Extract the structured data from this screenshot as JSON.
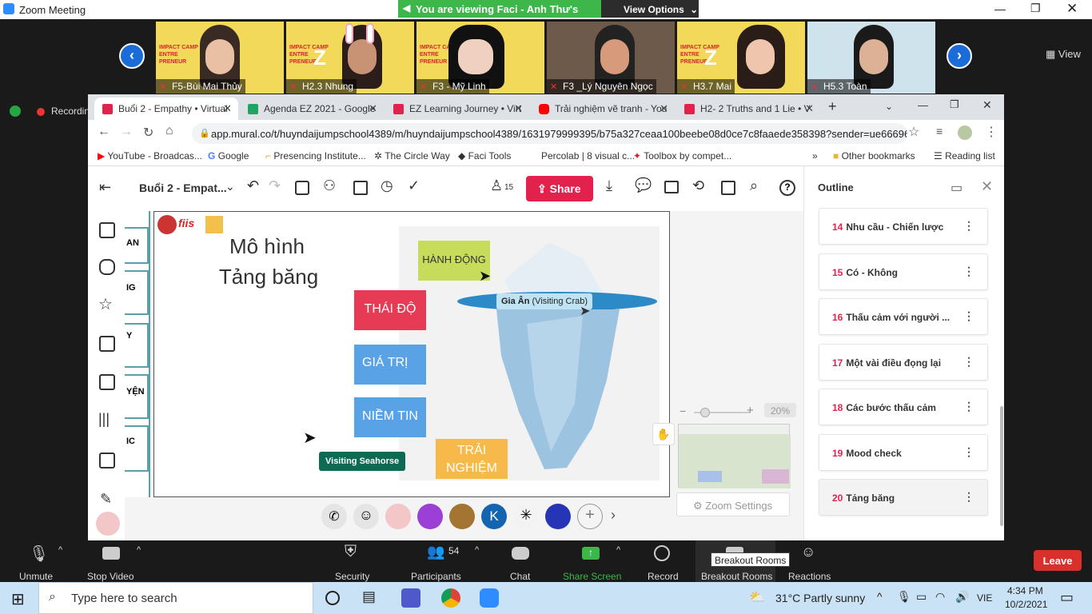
{
  "zoom": {
    "title": "Zoom Meeting",
    "share_banner": "You are viewing Faci - Anh Thư's screen",
    "view_options": "View Options",
    "view_label": "View",
    "recording": "Recordin"
  },
  "participants": [
    {
      "name": "F5-Bùi Mai Thủy"
    },
    {
      "name": "H2.3 Nhung"
    },
    {
      "name": "F3 - Mỹ Linh"
    },
    {
      "name": "F3 _Lý Nguyên Ngọc"
    },
    {
      "name": "H3.7 Mai"
    },
    {
      "name": "H5.3 Toàn"
    }
  ],
  "browser": {
    "tabs": [
      {
        "label": "Buổi 2 - Empathy • Virtual",
        "color": "#e2214d"
      },
      {
        "label": "Agenda EZ 2021 - Google",
        "color": "#1fa463"
      },
      {
        "label": "EZ Learning Journey • Virt",
        "color": "#e2214d"
      },
      {
        "label": "Trải nghiệm vẽ tranh - You",
        "color": "#ff0000"
      },
      {
        "label": "H2- 2 Truths and 1 Lie • V",
        "color": "#e2214d"
      }
    ],
    "url": "app.mural.co/t/huyndaijumpschool4389/m/huyndaijumpschool4389/1631979999395/b75a327ceaa100beebe08d0ce7c8faaede358398?sender=ue6669626...",
    "bookmarks": [
      "YouTube - Broadcas...",
      "Google",
      "Presencing Institute...",
      "The Circle Way",
      "Faci Tools",
      "Percolab | 8 visual c...",
      "Toolbox by compet..."
    ],
    "other_bookmarks": "Other bookmarks",
    "reading_list": "Reading list"
  },
  "mural": {
    "board_title": "Buổi 2 - Empat...",
    "member_count": "15",
    "share_label": "Share",
    "outline_title": "Outline",
    "outline_items": [
      {
        "num": "14",
        "label": "Nhu cầu - Chiến lược"
      },
      {
        "num": "15",
        "label": "Có - Không"
      },
      {
        "num": "16",
        "label": "Thấu cảm với người ..."
      },
      {
        "num": "17",
        "label": "Một vài điều đọng lại"
      },
      {
        "num": "18",
        "label": "Các bước thấu cảm"
      },
      {
        "num": "19",
        "label": "Mood check"
      },
      {
        "num": "20",
        "label": "Tảng băng"
      }
    ],
    "side_labels": [
      "AN",
      "IG",
      "Y",
      "YỆN",
      "IC"
    ],
    "zoom_percent": "20%",
    "zoom_settings": "Zoom Settings",
    "frame_title_1": "Mô hình",
    "frame_title_2": "Tảng băng",
    "sticky": {
      "hanh_dong": "HÀNH ĐỘNG",
      "thai_do": "THÁI ĐỘ",
      "gia_tri": "GIÁ TRỊ",
      "niem_tin": "NIỀM TIN",
      "trai_nghiem_1": "TRẢI",
      "trai_nghiem_2": "NGHIỆM"
    },
    "cursor_gia_an_name": "Gia Ân",
    "cursor_gia_an_animal": "(Visiting Crab)",
    "cursor_seahorse": "Visiting Seahorse",
    "avatar_k": "K",
    "fiis_logo": "fiis"
  },
  "controls": {
    "unmute": "Unmute",
    "stop_video": "Stop Video",
    "security": "Security",
    "participants": "Participants",
    "participants_count": "54",
    "chat": "Chat",
    "share_screen": "Share Screen",
    "record": "Record",
    "breakout_rooms": "Breakout Rooms",
    "breakout_tooltip": "Breakout Rooms",
    "reactions": "Reactions",
    "leave": "Leave"
  },
  "taskbar": {
    "search_placeholder": "Type here to search",
    "weather": "31°C  Partly sunny",
    "lang": "VIE",
    "time": "4:34 PM",
    "date": "10/2/2021"
  }
}
